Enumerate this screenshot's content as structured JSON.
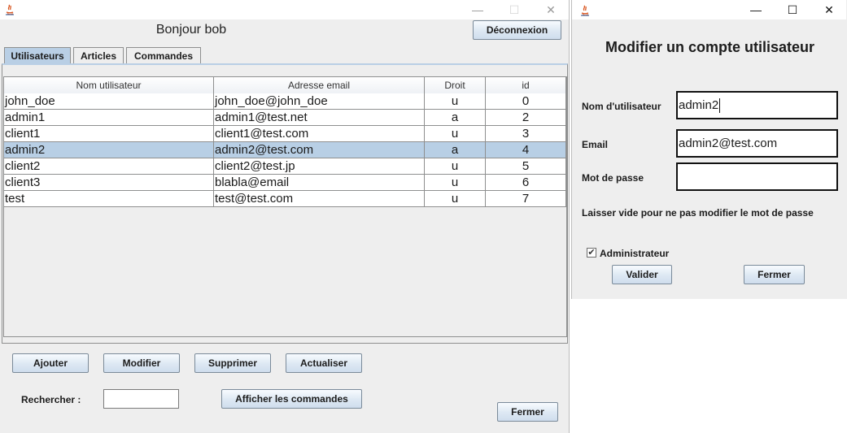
{
  "main_window": {
    "title_buttons": {
      "minimize": "—",
      "maximize": "☐",
      "close": "✕"
    },
    "greeting": "Bonjour bob",
    "logout_label": "Déconnexion",
    "tabs": [
      {
        "label": "Utilisateurs",
        "active": true
      },
      {
        "label": "Articles",
        "active": false
      },
      {
        "label": "Commandes",
        "active": false
      }
    ],
    "table": {
      "columns": [
        "Nom utilisateur",
        "Adresse email",
        "Droit",
        "id"
      ],
      "rows": [
        {
          "name": "john_doe",
          "email": "john_doe@john_doe",
          "right": "u",
          "id": "0",
          "selected": false
        },
        {
          "name": "admin1",
          "email": "admin1@test.net",
          "right": "a",
          "id": "2",
          "selected": false
        },
        {
          "name": "client1",
          "email": "client1@test.com",
          "right": "u",
          "id": "3",
          "selected": false
        },
        {
          "name": "admin2",
          "email": "admin2@test.com",
          "right": "a",
          "id": "4",
          "selected": true
        },
        {
          "name": "client2",
          "email": "client2@test.jp",
          "right": "u",
          "id": "5",
          "selected": false
        },
        {
          "name": "client3",
          "email": "blabla@email",
          "right": "u",
          "id": "6",
          "selected": false
        },
        {
          "name": "test",
          "email": "test@test.com",
          "right": "u",
          "id": "7",
          "selected": false
        }
      ]
    },
    "actions": {
      "add": "Ajouter",
      "modify": "Modifier",
      "delete": "Supprimer",
      "refresh": "Actualiser"
    },
    "search_label": "Rechercher :",
    "search_value": "",
    "show_orders_label": "Afficher les commandes",
    "close_label": "Fermer"
  },
  "dialog": {
    "title_buttons": {
      "minimize": "—",
      "maximize": "☐",
      "close": "✕"
    },
    "heading": "Modifier un compte utilisateur",
    "username_label": "Nom d'utilisateur",
    "username_value": "admin2",
    "email_label": "Email",
    "email_value": "admin2@test.com",
    "password_label": "Mot de passe",
    "password_value": "",
    "password_hint": "Laisser vide pour ne pas modifier le mot de passe",
    "admin_checkbox_label": "Administrateur",
    "admin_checked": true,
    "check_mark": "✔",
    "validate_label": "Valider",
    "close_label": "Fermer"
  }
}
